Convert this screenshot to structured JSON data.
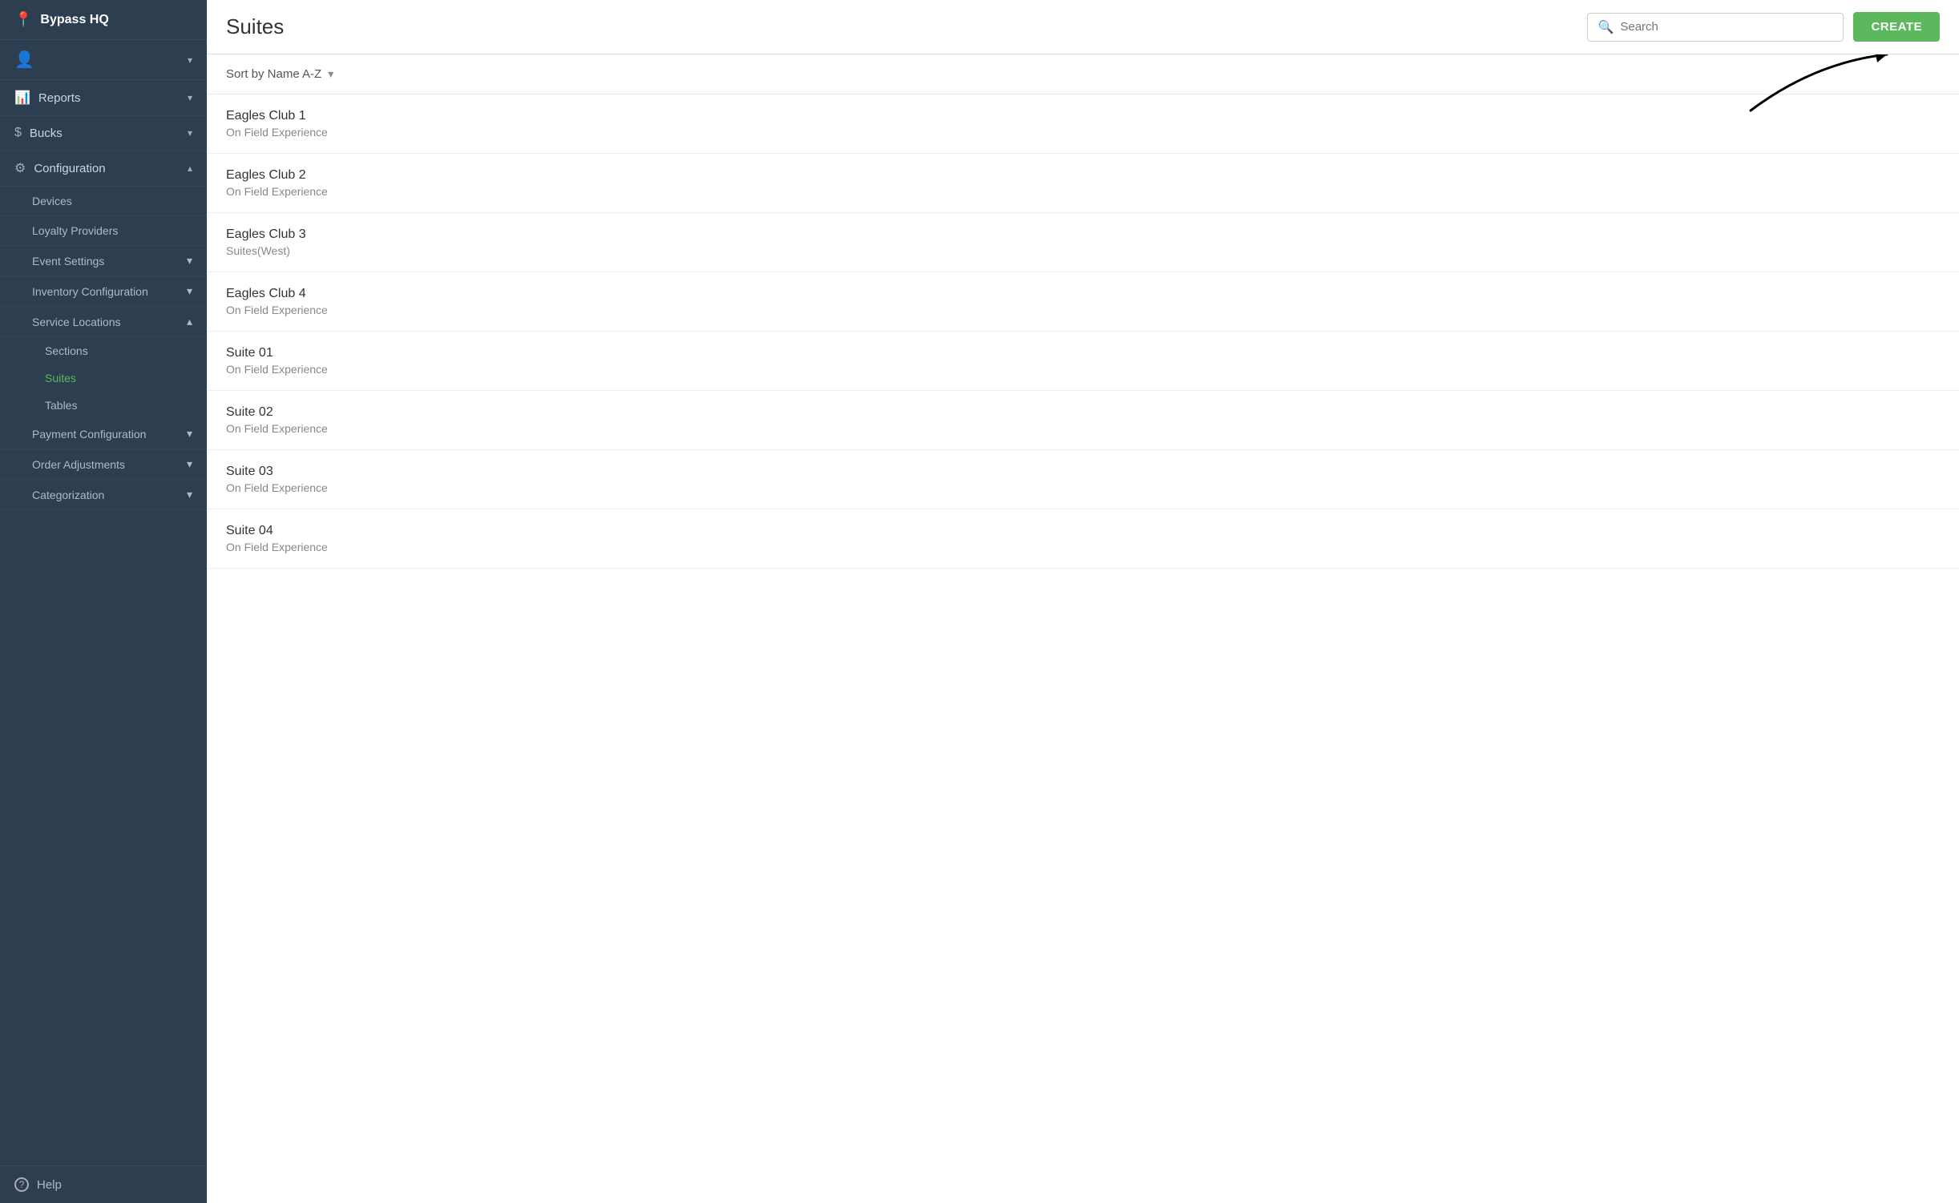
{
  "brand": {
    "name": "Bypass HQ",
    "location_icon": "📍"
  },
  "sidebar": {
    "user_icon": "👤",
    "items": [
      {
        "id": "reports",
        "label": "Reports",
        "icon": "📊",
        "has_chevron": true,
        "expanded": false
      },
      {
        "id": "bucks",
        "label": "Bucks",
        "icon": "$",
        "has_chevron": true,
        "expanded": false
      },
      {
        "id": "configuration",
        "label": "Configuration",
        "icon": "⚙",
        "has_chevron": true,
        "expanded": true
      }
    ],
    "config_sub_items": [
      {
        "id": "devices",
        "label": "Devices",
        "expanded": false
      },
      {
        "id": "loyalty-providers",
        "label": "Loyalty Providers",
        "expanded": false
      },
      {
        "id": "event-settings",
        "label": "Event Settings",
        "has_chevron": true,
        "expanded": false
      },
      {
        "id": "inventory-configuration",
        "label": "Inventory Configuration",
        "has_chevron": true,
        "expanded": false
      },
      {
        "id": "service-locations",
        "label": "Service Locations",
        "has_chevron": true,
        "expanded": true
      }
    ],
    "service_location_sub_items": [
      {
        "id": "sections",
        "label": "Sections",
        "active": false
      },
      {
        "id": "suites",
        "label": "Suites",
        "active": true
      },
      {
        "id": "tables",
        "label": "Tables",
        "active": false
      }
    ],
    "more_items": [
      {
        "id": "payment-configuration",
        "label": "Payment Configuration",
        "has_chevron": true
      },
      {
        "id": "order-adjustments",
        "label": "Order Adjustments",
        "has_chevron": true
      },
      {
        "id": "categorization",
        "label": "Categorization",
        "has_chevron": true
      }
    ],
    "help_label": "Help"
  },
  "topbar": {
    "title": "Suites",
    "search_placeholder": "Search",
    "create_label": "CREATE"
  },
  "sort": {
    "label": "Sort by Name A-Z"
  },
  "suites": [
    {
      "name": "Eagles Club 1",
      "sub": "On Field Experience"
    },
    {
      "name": "Eagles Club 2",
      "sub": "On Field Experience"
    },
    {
      "name": "Eagles Club 3",
      "sub": "Suites(West)"
    },
    {
      "name": "Eagles Club 4",
      "sub": "On Field Experience"
    },
    {
      "name": "Suite 01",
      "sub": "On Field Experience"
    },
    {
      "name": "Suite 02",
      "sub": "On Field Experience"
    },
    {
      "name": "Suite 03",
      "sub": "On Field Experience"
    },
    {
      "name": "Suite 04",
      "sub": "On Field Experience"
    }
  ]
}
